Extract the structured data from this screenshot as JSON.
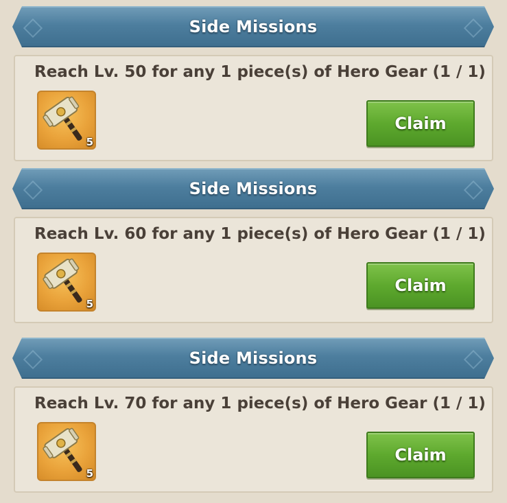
{
  "missions": [
    {
      "header": "Side Missions",
      "text": "Reach Lv. 50 for any 1 piece(s) of Hero Gear (1 / 1)",
      "item_icon": "hammer-icon",
      "item_count": "5",
      "button_label": "Claim"
    },
    {
      "header": "Side Missions",
      "text": "Reach Lv. 60 for any 1 piece(s) of Hero Gear (1 / 1)",
      "item_icon": "hammer-icon",
      "item_count": "5",
      "button_label": "Claim"
    },
    {
      "header": "Side Missions",
      "text": "Reach Lv. 70 for any 1 piece(s) of Hero Gear (1 / 1)",
      "item_icon": "hammer-icon",
      "item_count": "5",
      "button_label": "Claim"
    }
  ],
  "colors": {
    "banner": "#4d7e9e",
    "claim_button": "#5ea92e",
    "background": "#e4dccd",
    "card": "#ebe5d9"
  }
}
